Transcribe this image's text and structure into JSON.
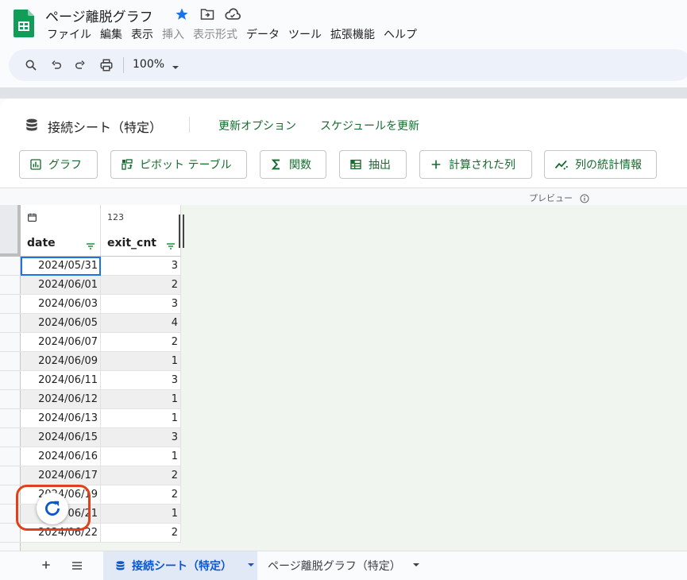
{
  "window": {
    "doc_title": "ページ離脱グラフ",
    "menus": [
      {
        "label": "ファイル",
        "disabled": false
      },
      {
        "label": "編集",
        "disabled": false
      },
      {
        "label": "表示",
        "disabled": false
      },
      {
        "label": "挿入",
        "disabled": true
      },
      {
        "label": "表示形式",
        "disabled": true
      },
      {
        "label": "データ",
        "disabled": false
      },
      {
        "label": "ツール",
        "disabled": false
      },
      {
        "label": "拡張機能",
        "disabled": false
      },
      {
        "label": "ヘルプ",
        "disabled": false
      }
    ]
  },
  "toolbar": {
    "zoom": "100%"
  },
  "panel": {
    "title": "接続シート（特定）",
    "links": [
      "更新オプション",
      "スケジュールを更新"
    ],
    "buttons": [
      "グラフ",
      "ピボット テーブル",
      "関数",
      "抽出",
      "計算された列",
      "列の統計情報"
    ],
    "preview_label": "プレビュー"
  },
  "grid": {
    "columns": [
      {
        "name": "date",
        "type_label": ""
      },
      {
        "name": "exit_cnt",
        "type_label": "123"
      }
    ],
    "rows": [
      [
        "2024/05/31",
        "3"
      ],
      [
        "2024/06/01",
        "2"
      ],
      [
        "2024/06/03",
        "3"
      ],
      [
        "2024/06/05",
        "4"
      ],
      [
        "2024/06/07",
        "2"
      ],
      [
        "2024/06/09",
        "1"
      ],
      [
        "2024/06/11",
        "3"
      ],
      [
        "2024/06/12",
        "1"
      ],
      [
        "2024/06/13",
        "1"
      ],
      [
        "2024/06/15",
        "3"
      ],
      [
        "2024/06/16",
        "1"
      ],
      [
        "2024/06/17",
        "2"
      ],
      [
        "2024/06/19",
        "2"
      ],
      [
        "2024/06/21",
        "1"
      ],
      [
        "2024/06/22",
        "2"
      ]
    ]
  },
  "sheet_tabs": {
    "active": "接続シート（特定）",
    "other": "ページ離脱グラフ（特定）"
  },
  "colors": {
    "accent_green": "#146c2e",
    "tab_blue": "#0b57d0",
    "annotation_red": "#e2401c"
  }
}
